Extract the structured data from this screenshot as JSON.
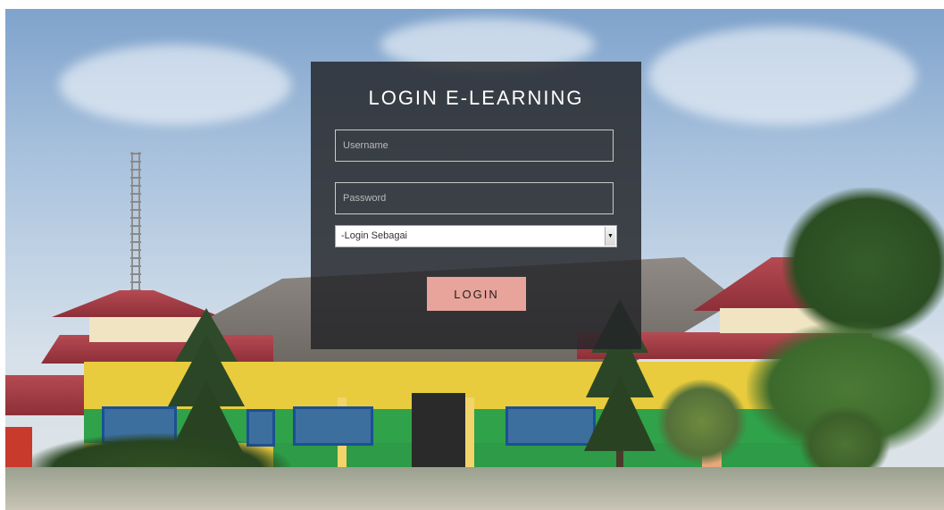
{
  "login": {
    "title": "LOGIN E-LEARNING",
    "username_placeholder": "Username",
    "password_placeholder": "Password",
    "role_select": {
      "selected": "-Login Sebagai"
    },
    "submit_label": "LOGIN"
  },
  "colors": {
    "panel_bg": "#232428",
    "button_bg": "#e8a39b",
    "text": "#ffffff"
  },
  "icons": {
    "select_arrow": "chevron-down-icon"
  }
}
